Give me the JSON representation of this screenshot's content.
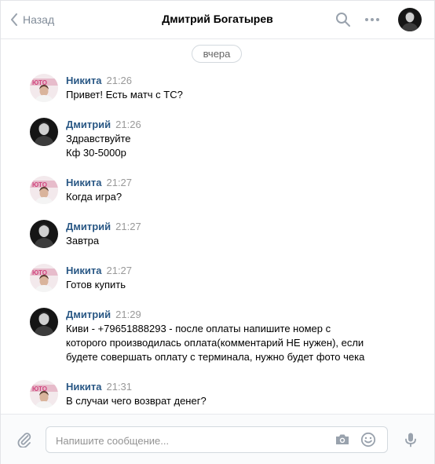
{
  "header": {
    "back_label": "Назад",
    "title": "Дмитрий Богатырев",
    "icons": [
      "chevron-left-icon",
      "search-icon",
      "more-icon"
    ]
  },
  "date_separator": "вчера",
  "messages": [
    {
      "author": "Никита",
      "time": "21:26",
      "lines": [
        "Привет! Есть матч с ТС?"
      ]
    },
    {
      "author": "Дмитрий",
      "time": "21:26",
      "lines": [
        "Здравствуйте",
        "Кф 30-5000р"
      ]
    },
    {
      "author": "Никита",
      "time": "21:27",
      "lines": [
        "Когда игра?"
      ]
    },
    {
      "author": "Дмитрий",
      "time": "21:27",
      "lines": [
        "Завтра"
      ]
    },
    {
      "author": "Никита",
      "time": "21:27",
      "lines": [
        "Готов купить"
      ]
    },
    {
      "author": "Дмитрий",
      "time": "21:29",
      "lines": [
        "Киви - +79651888293 - после оплаты напишите номер с",
        "которого производилась оплата(комментарий НЕ нужен), если",
        "будете совершать оплату с терминала, нужно будет фото чека"
      ]
    },
    {
      "author": "Никита",
      "time": "21:31",
      "lines": [
        "В случаи чего возврат денег?"
      ]
    }
  ],
  "composer": {
    "placeholder": "Напишите сообщение...",
    "value": "",
    "icons": [
      "paperclip-icon",
      "camera-icon",
      "smile-icon",
      "microphone-icon"
    ]
  },
  "colors": {
    "author": "#2a5885",
    "time": "#999999",
    "icon": "#99a2ad",
    "border": "#e7e8ec"
  }
}
